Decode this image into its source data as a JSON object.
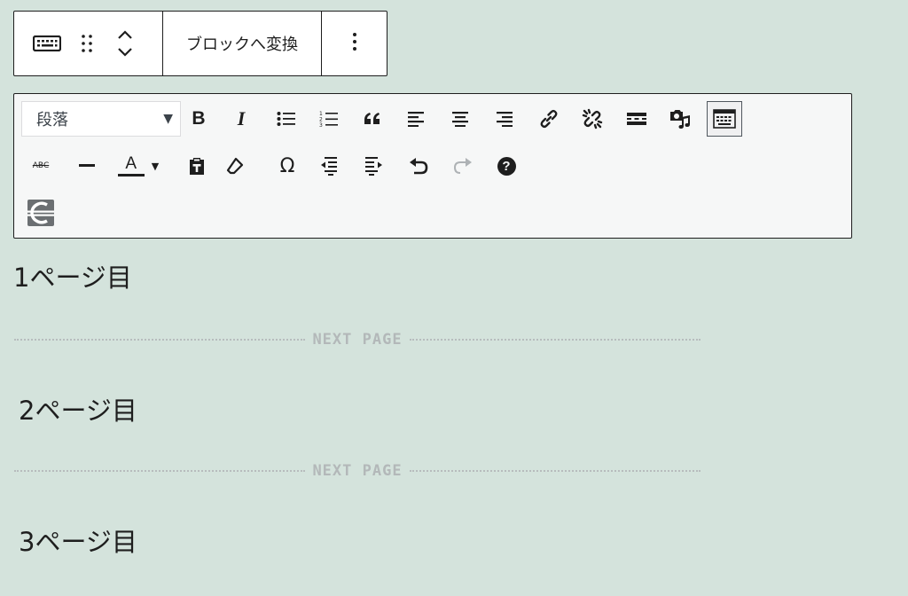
{
  "block_toolbar": {
    "convert_label": "ブロックへ変換",
    "icons": [
      "keyboard-icon",
      "drag-handle-icon",
      "move-up-down-icon",
      "more-options-icon"
    ]
  },
  "classic_toolbar": {
    "format_select": {
      "value": "段落"
    },
    "row1_icons": [
      "bold-icon",
      "italic-icon",
      "bulleted-list-icon",
      "numbered-list-icon",
      "blockquote-icon",
      "align-left-icon",
      "align-center-icon",
      "align-right-icon",
      "link-icon",
      "unlink-icon",
      "read-more-icon",
      "media-icon",
      "toolbar-toggle-icon"
    ],
    "row2_icons": [
      "strikethrough-icon",
      "horizontal-rule-icon",
      "text-color-icon",
      "paste-as-text-icon",
      "clear-formatting-icon",
      "special-character-icon",
      "outdent-icon",
      "indent-icon",
      "undo-icon",
      "redo-icon",
      "help-icon"
    ],
    "row3_icons": [
      "page-break-icon"
    ],
    "bold_glyph": "B",
    "italic_glyph": "I",
    "quote_glyph": "66",
    "strike_glyph": "ABC",
    "textcolor_glyph": "A",
    "omega_glyph": "Ω",
    "help_glyph": "?"
  },
  "content": {
    "pages": [
      "1ページ目",
      "2ページ目",
      "3ページ目"
    ],
    "separator_label": "NEXT PAGE"
  }
}
